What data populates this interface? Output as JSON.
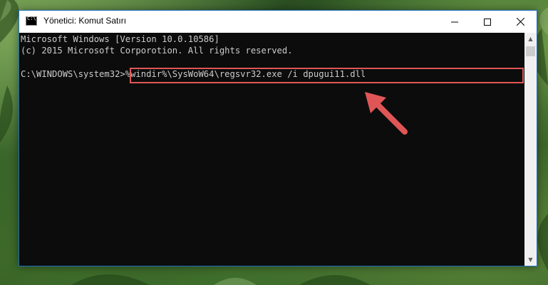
{
  "window": {
    "title": "Yönetici: Komut Satırı"
  },
  "console": {
    "line1": "Microsoft Windows [Version 10.0.10586]",
    "line2": "(c) 2015 Microsoft Corporotion. All rights reserved.",
    "prompt": "C:\\WINDOWS\\system32>",
    "command": "%windir%\\SysWoW64\\regsvr32.exe /i dpugui11.dll"
  },
  "colors": {
    "console_bg": "#0c0c0c",
    "console_text": "#cccccc",
    "highlight": "#e05656"
  },
  "icons": {
    "minimize": "minimize-icon",
    "maximize": "maximize-icon",
    "close": "close-icon",
    "app": "cmd-icon"
  }
}
